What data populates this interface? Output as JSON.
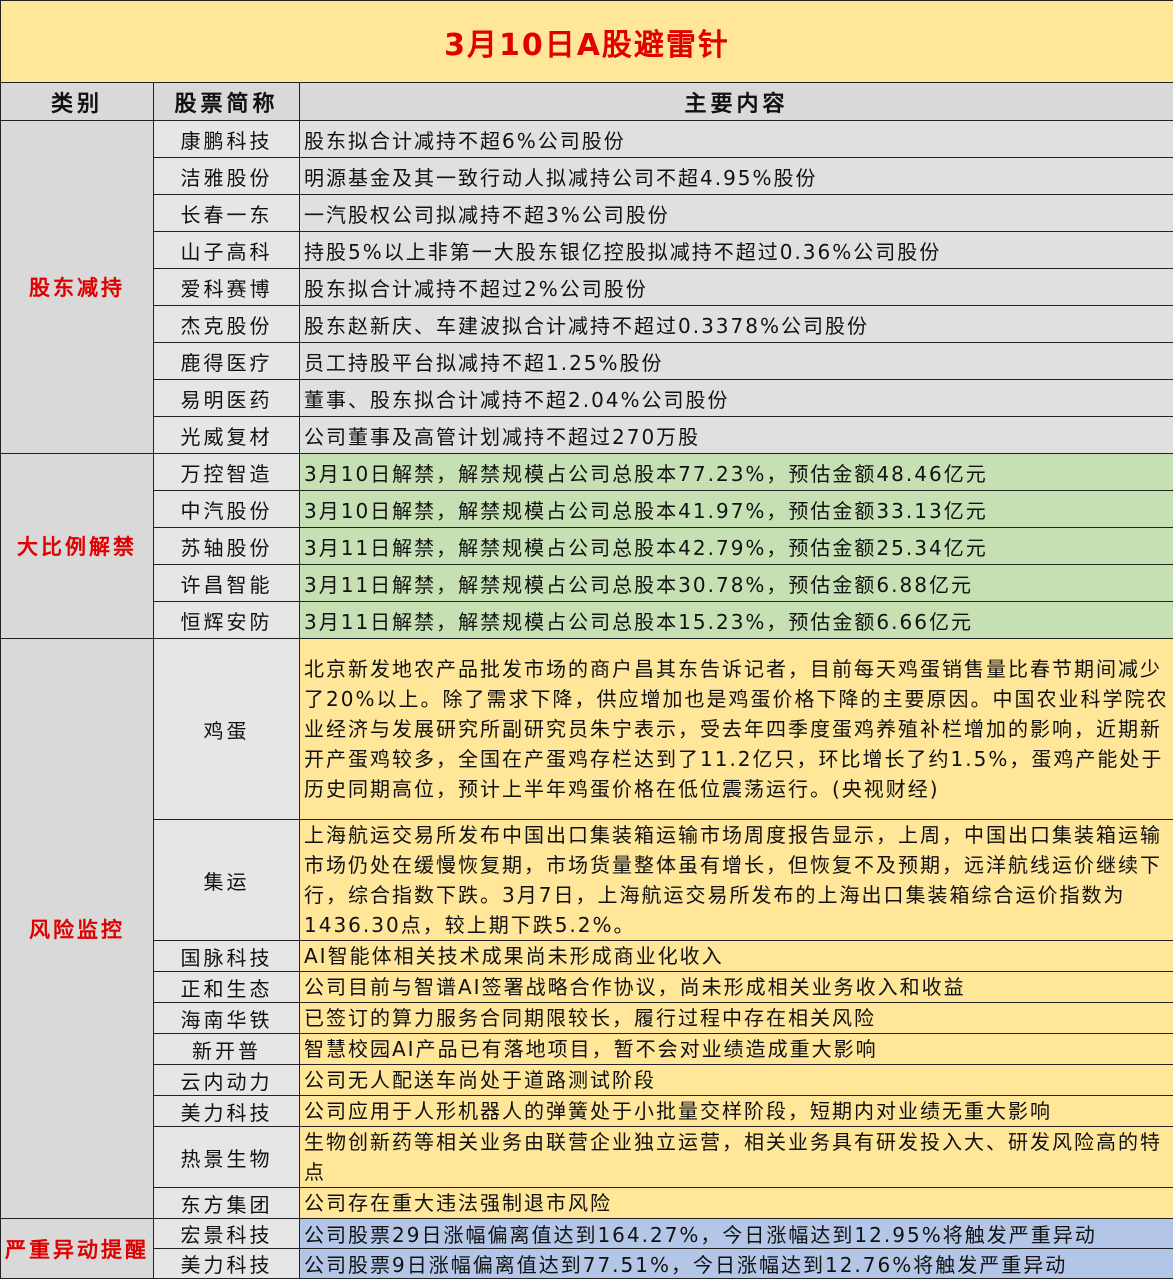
{
  "title": "3月10日A股避雷针",
  "headers": [
    "类别",
    "股票简称",
    "主要内容"
  ],
  "sections": [
    {
      "category": "股东减持",
      "rows": [
        {
          "name": "康鹏科技",
          "content": "股东拟合计减持不超6%公司股份"
        },
        {
          "name": "洁雅股份",
          "content": "明源基金及其一致行动人拟减持公司不超4.95%股份"
        },
        {
          "name": "长春一东",
          "content": "一汽股权公司拟减持不超3%公司股份"
        },
        {
          "name": "山子高科",
          "content": "持股5%以上非第一大股东银亿控股拟减持不超过0.36%公司股份"
        },
        {
          "name": "爱科赛博",
          "content": "股东拟合计减持不超过2%公司股份"
        },
        {
          "name": "杰克股份",
          "content": "股东赵新庆、车建波拟合计减持不超过0.3378%公司股份"
        },
        {
          "name": "鹿得医疗",
          "content": "员工持股平台拟减持不超1.25%股份"
        },
        {
          "name": "易明医药",
          "content": "董事、股东拟合计减持不超2.04%公司股份"
        },
        {
          "name": "光威复材",
          "content": "公司董事及高管计划减持不超过270万股"
        }
      ]
    },
    {
      "category": "大比例解禁",
      "rows": [
        {
          "name": "万控智造",
          "content": "3月10日解禁，解禁规模占公司总股本77.23%，预估金额48.46亿元"
        },
        {
          "name": "中汽股份",
          "content": "3月10日解禁，解禁规模占公司总股本41.97%，预估金额33.13亿元"
        },
        {
          "name": "苏轴股份",
          "content": "3月11日解禁，解禁规模占公司总股本42.79%，预估金额25.34亿元"
        },
        {
          "name": "许昌智能",
          "content": "3月11日解禁，解禁规模占公司总股本30.78%，预估金额6.88亿元"
        },
        {
          "name": "恒辉安防",
          "content": "3月11日解禁，解禁规模占公司总股本15.23%，预估金额6.66亿元"
        }
      ]
    },
    {
      "category": "风险监控",
      "rows": [
        {
          "name": "鸡蛋",
          "content": "北京新发地农产品批发市场的商户昌其东告诉记者，目前每天鸡蛋销售量比春节期间减少了20%以上。除了需求下降，供应增加也是鸡蛋价格下降的主要原因。中国农业科学院农业经济与发展研究所副研究员朱宁表示，受去年四季度蛋鸡养殖补栏增加的影响，近期新开产蛋鸡较多，全国在产蛋鸡存栏达到了11.2亿只，环比增长了约1.5%，蛋鸡产能处于历史同期高位，预计上半年鸡蛋价格在低位震荡运行。(央视财经)"
        },
        {
          "name": "集运",
          "content": "上海航运交易所发布中国出口集装箱运输市场周度报告显示，上周，中国出口集装箱运输市场仍处在缓慢恢复期，市场货量整体虽有增长，但恢复不及预期，远洋航线运价继续下行，综合指数下跌。3月7日，上海航运交易所发布的上海出口集装箱综合运价指数为1436.30点，较上期下跌5.2%。"
        },
        {
          "name": "国脉科技",
          "content": "AI智能体相关技术成果尚未形成商业化收入"
        },
        {
          "name": "正和生态",
          "content": "公司目前与智谱AI签署战略合作协议，尚未形成相关业务收入和收益"
        },
        {
          "name": "海南华铁",
          "content": "已签订的算力服务合同期限较长，履行过程中存在相关风险"
        },
        {
          "name": "新开普",
          "content": "智慧校园AI产品已有落地项目，暂不会对业绩造成重大影响"
        },
        {
          "name": "云内动力",
          "content": "公司无人配送车尚处于道路测试阶段"
        },
        {
          "name": "美力科技",
          "content": "公司应用于人形机器人的弹簧处于小批量交样阶段，短期内对业绩无重大影响"
        },
        {
          "name": "热景生物",
          "content": "生物创新药等相关业务由联营企业独立运营，相关业务具有研发投入大、研发风险高的特点"
        },
        {
          "name": "东方集团",
          "content": "公司存在重大违法强制退市风险"
        }
      ]
    },
    {
      "category": "严重异动提醒",
      "rows": [
        {
          "name": "宏景科技",
          "content": "公司股票29日涨幅偏离值达到164.27%，今日涨幅达到12.95%将触发严重异动"
        },
        {
          "name": "美力科技",
          "content": "公司股票9日涨幅偏离值达到77.51%，今日涨幅达到12.76%将触发严重异动"
        }
      ]
    }
  ]
}
